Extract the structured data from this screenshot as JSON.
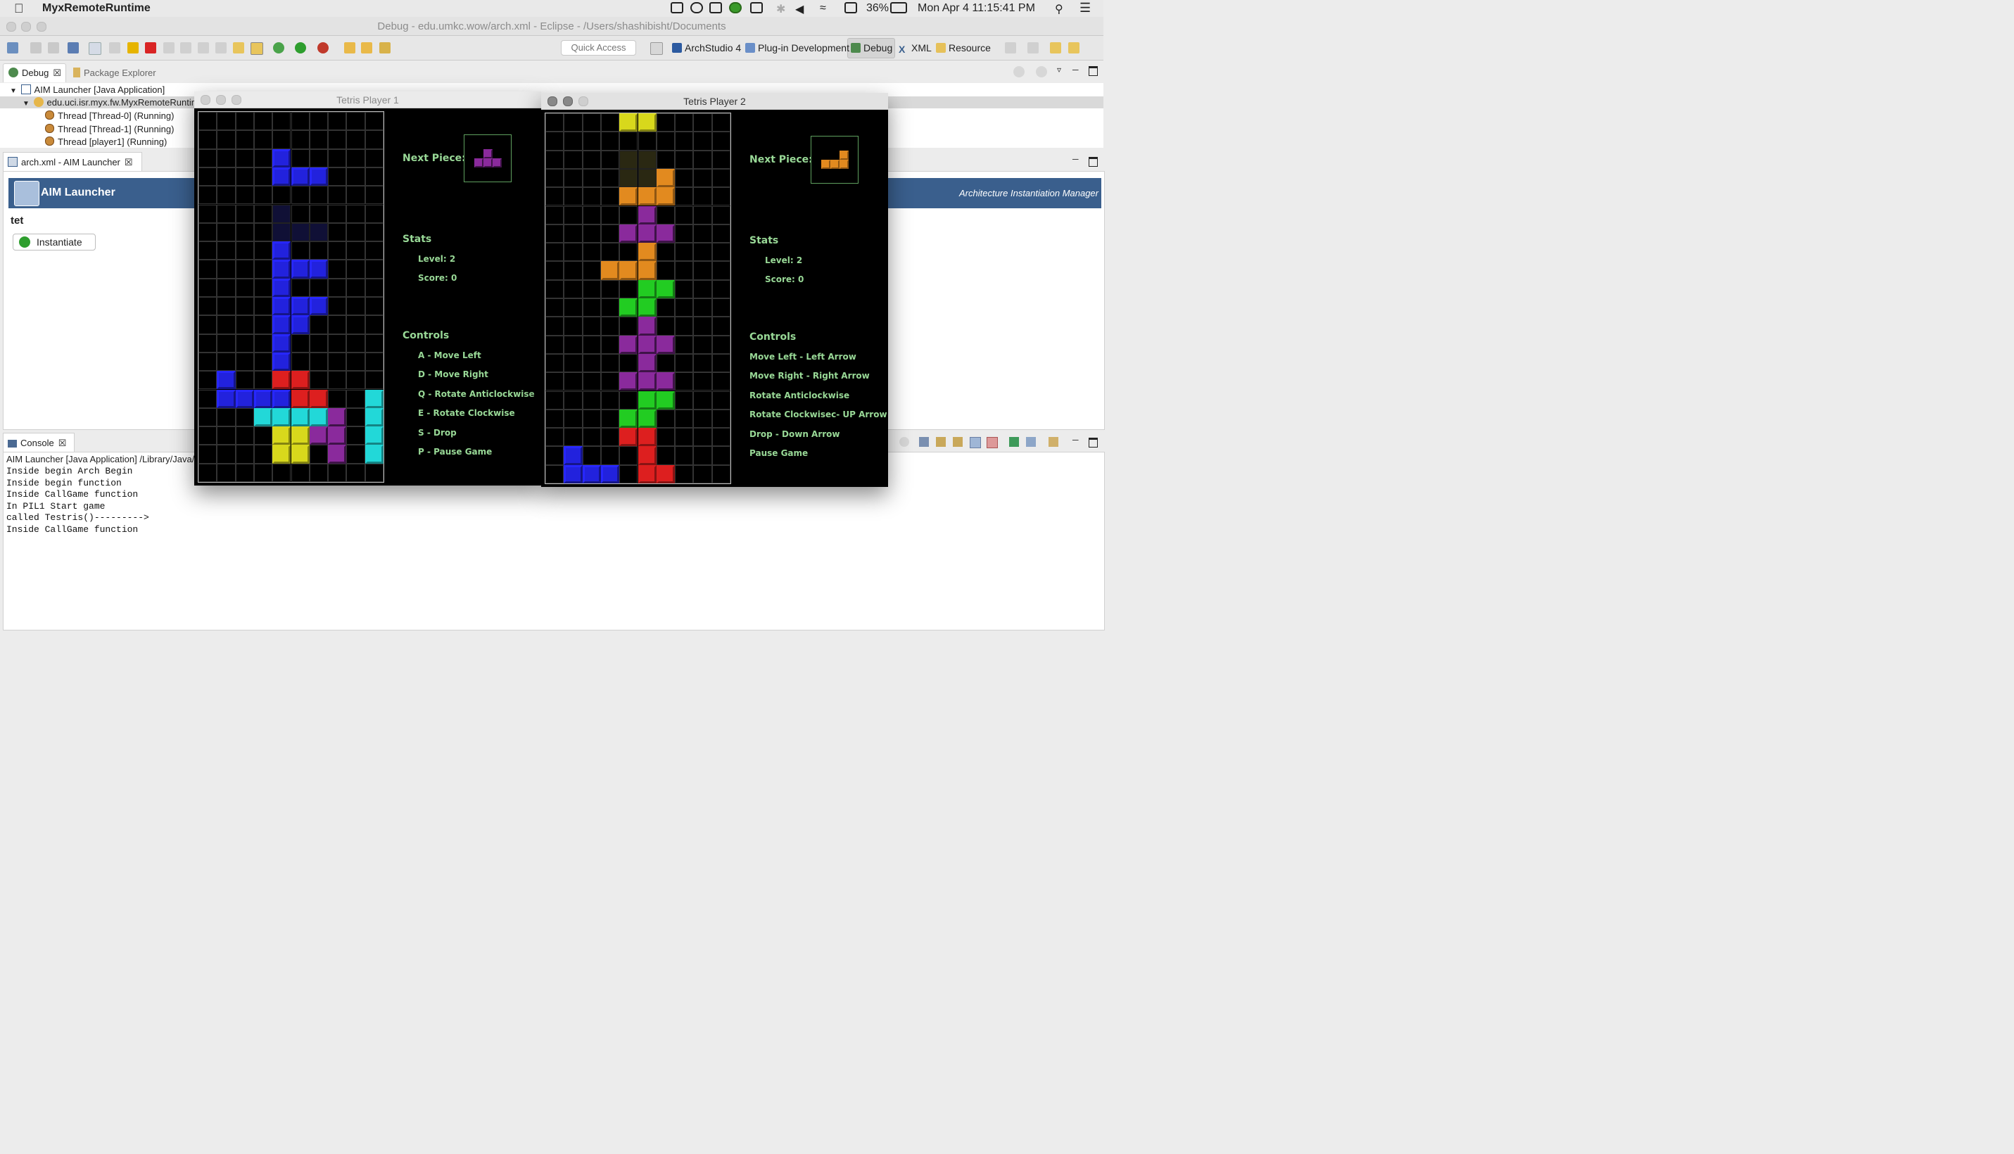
{
  "menubar": {
    "app_name": "MyxRemoteRuntime",
    "battery": "36%",
    "datetime": "Mon Apr 4  11:15:41 PM",
    "icons": [
      "apple-icon",
      "screen-icon",
      "play-icon",
      "display-icon",
      "w-icon",
      "airplay-icon",
      "bluetooth-icon",
      "volume-icon",
      "wifi-icon",
      "keyboard-icon",
      "battery-icon",
      "search-icon",
      "menu-icon"
    ]
  },
  "window": {
    "title": "Debug - edu.umkc.wow/arch.xml - Eclipse - /Users/shashibisht/Documents"
  },
  "toolbar": {
    "quick_access_placeholder": "Quick Access",
    "perspectives": [
      "ArchStudio 4",
      "Plug-in Development",
      "Debug",
      "XML",
      "Resource"
    ]
  },
  "debug_view": {
    "tabs": [
      "Debug",
      "Package Explorer"
    ],
    "tree": [
      "AIM Launcher [Java Application]",
      "edu.uci.isr.myx.fw.MyxRemoteRuntim",
      "Thread [Thread-0] (Running)",
      "Thread [Thread-1] (Running)",
      "Thread [player1] (Running)"
    ]
  },
  "editor": {
    "tab_label": "arch.xml - AIM Launcher",
    "header_title": "AIM Launcher",
    "header_subtitle": "Architecture Instantiation Manager",
    "section": "tet",
    "instantiate_label": "Instantiate"
  },
  "console": {
    "tab_label": "Console",
    "header": "AIM Launcher [Java Application] /Library/Java/",
    "lines": [
      "Inside begin Arch Begin",
      "Inside begin function",
      "Inside CallGame function",
      "In PIL1 Start game",
      "called Testris()--------->",
      "Inside CallGame function"
    ]
  },
  "colors": {
    "blue": "#2222dd",
    "red": "#dd1f1f",
    "cyan": "#22d8d8",
    "yellow": "#d8d81c",
    "purple": "#8a2a9c",
    "orange": "#e28a1f",
    "green": "#22cc22",
    "ghost": "#101036",
    "shadow": "#2a2812",
    "panel_text": "#98d896"
  },
  "players": [
    {
      "title": "Tetris Player 1",
      "next_label": "Next Piece:",
      "next_piece": "T",
      "next_color": "purple",
      "stats_label": "Stats",
      "level": "Level: 2",
      "score": "Score: 0",
      "controls_label": "Controls",
      "controls": [
        "A - Move Left",
        "D - Move Right",
        "Q - Rotate Anticlockwise",
        "E - Rotate Clockwise",
        "S - Drop",
        "P - Pause Game"
      ],
      "board": [
        "..........",
        "..........",
        "....b.....",
        "....bbb...",
        "..........",
        "....g.....",
        "....ggg...",
        "....b.....",
        "....bbb...",
        "....b.....",
        "....bbb...",
        "....bb....",
        "....b.....",
        "....b.....",
        ".b..rr....",
        ".bbbbrr..c",
        "...ccccp.c",
        "....yypp.c",
        "....yy.p.c"
      ]
    },
    {
      "title": "Tetris Player 2",
      "next_label": "Next Piece:",
      "next_piece": "L",
      "next_color": "orange",
      "stats_label": "Stats",
      "level": "Level: 2",
      "score": "Score: 0",
      "controls_label": "Controls",
      "controls": [
        "Move Left - Left Arrow",
        "Move Right - Right Arrow",
        "Rotate Anticlockwise",
        "Rotate Clockwisec- UP Arrow",
        "Drop - Down Arrow",
        "Pause Game"
      ],
      "board": [
        "....yy....",
        "..........",
        "....ss....",
        "....sso...",
        "....ooo...",
        ".....p....",
        "....ppp...",
        ".....o....",
        "...ooo....",
        ".....gg...",
        "....gg....",
        ".....p....",
        "....ppp...",
        ".....p....",
        "....ppp...",
        ".....gg...",
        "....gg....",
        "....rr....",
        ".b...r....",
        ".bbb.rr..."
      ]
    }
  ]
}
